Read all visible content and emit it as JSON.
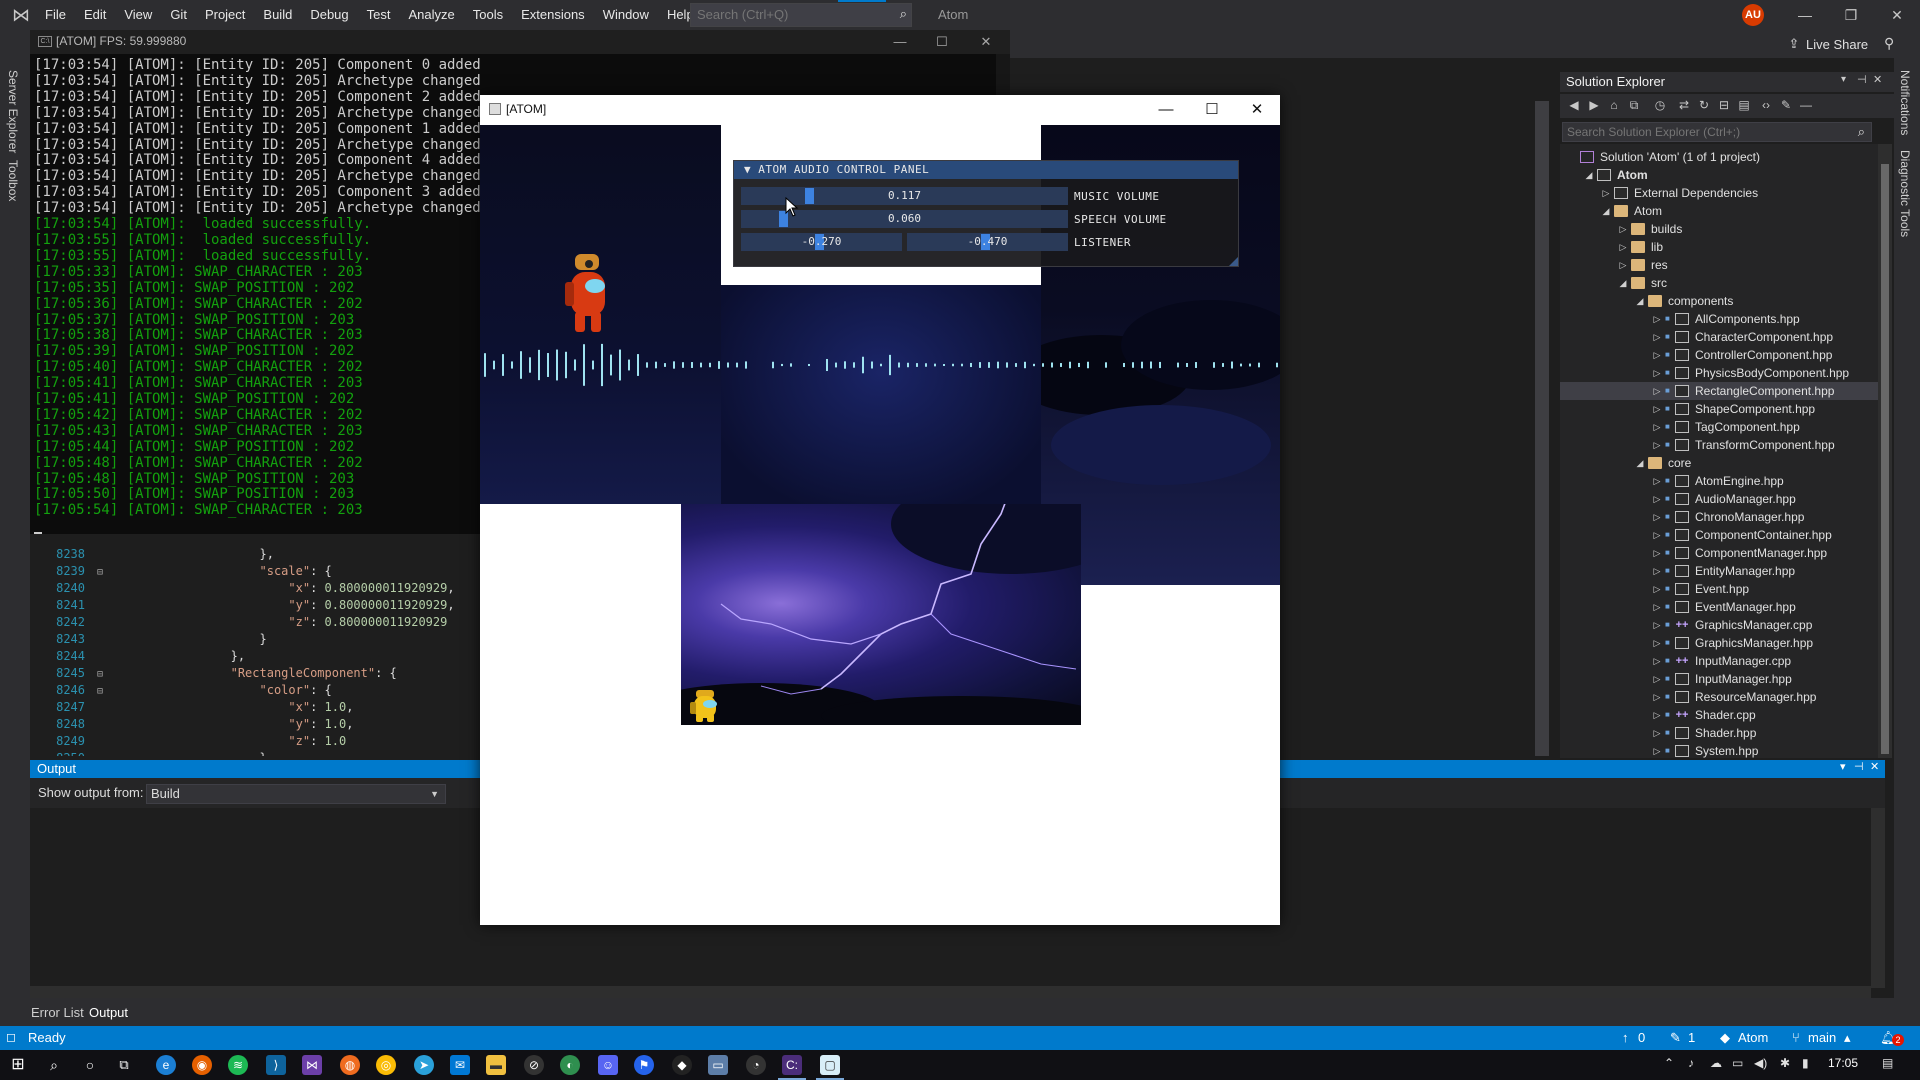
{
  "vs": {
    "menu": [
      "File",
      "Edit",
      "View",
      "Git",
      "Project",
      "Build",
      "Debug",
      "Test",
      "Analyze",
      "Tools",
      "Extensions",
      "Window",
      "Help"
    ],
    "search_placeholder": "Search (Ctrl+Q)",
    "solution_name": "Atom",
    "avatar_initials": "AU",
    "live_share": "Live Share",
    "left_tabs": [
      "Server Explorer",
      "Toolbox"
    ],
    "right_tabs": [
      "Notifications",
      "Diagnostic Tools"
    ]
  },
  "console": {
    "title": "[ATOM] FPS: 59.999880",
    "lines": [
      {
        "t": "[17:03:54] [ATOM]: [Entity ID: 205] Component 0 added",
        "c": "white"
      },
      {
        "t": "[17:03:54] [ATOM]: [Entity ID: 205] Archetype changed",
        "c": "white"
      },
      {
        "t": "[17:03:54] [ATOM]: [Entity ID: 205] Component 2 added",
        "c": "white"
      },
      {
        "t": "[17:03:54] [ATOM]: [Entity ID: 205] Archetype changed",
        "c": "white"
      },
      {
        "t": "[17:03:54] [ATOM]: [Entity ID: 205] Component 1 added",
        "c": "white"
      },
      {
        "t": "[17:03:54] [ATOM]: [Entity ID: 205] Archetype changed",
        "c": "white"
      },
      {
        "t": "[17:03:54] [ATOM]: [Entity ID: 205] Component 4 added",
        "c": "white"
      },
      {
        "t": "[17:03:54] [ATOM]: [Entity ID: 205] Archetype changed",
        "c": "white"
      },
      {
        "t": "[17:03:54] [ATOM]: [Entity ID: 205] Component 3 added",
        "c": "white"
      },
      {
        "t": "[17:03:54] [ATOM]: [Entity ID: 205] Archetype changed",
        "c": "white"
      },
      {
        "t": "[17:03:54] [ATOM]:  loaded successfully.",
        "c": "green"
      },
      {
        "t": "[17:03:55] [ATOM]:  loaded successfully.",
        "c": "green"
      },
      {
        "t": "[17:03:55] [ATOM]:  loaded successfully.",
        "c": "green"
      },
      {
        "t": "[17:05:33] [ATOM]: SWAP_CHARACTER : 203",
        "c": "green"
      },
      {
        "t": "[17:05:35] [ATOM]: SWAP_POSITION : 202",
        "c": "green"
      },
      {
        "t": "[17:05:36] [ATOM]: SWAP_CHARACTER : 202",
        "c": "green"
      },
      {
        "t": "[17:05:37] [ATOM]: SWAP_POSITION : 203",
        "c": "green"
      },
      {
        "t": "[17:05:38] [ATOM]: SWAP_CHARACTER : 203",
        "c": "green"
      },
      {
        "t": "[17:05:39] [ATOM]: SWAP_POSITION : 202",
        "c": "green"
      },
      {
        "t": "[17:05:40] [ATOM]: SWAP_CHARACTER : 202",
        "c": "green"
      },
      {
        "t": "[17:05:41] [ATOM]: SWAP_CHARACTER : 203",
        "c": "green"
      },
      {
        "t": "[17:05:41] [ATOM]: SWAP_POSITION : 202",
        "c": "green"
      },
      {
        "t": "[17:05:42] [ATOM]: SWAP_CHARACTER : 202",
        "c": "green"
      },
      {
        "t": "[17:05:43] [ATOM]: SWAP_CHARACTER : 203",
        "c": "green"
      },
      {
        "t": "[17:05:44] [ATOM]: SWAP_POSITION : 202",
        "c": "green"
      },
      {
        "t": "[17:05:48] [ATOM]: SWAP_CHARACTER : 202",
        "c": "green"
      },
      {
        "t": "[17:05:48] [ATOM]: SWAP_POSITION : 203",
        "c": "green"
      },
      {
        "t": "[17:05:50] [ATOM]: SWAP_POSITION : 203",
        "c": "green"
      },
      {
        "t": "[17:05:54] [ATOM]: SWAP_CHARACTER : 203",
        "c": "green"
      }
    ]
  },
  "editor": {
    "rows": [
      {
        "n": "8238",
        "fold": "",
        "code": [
          {
            "c": "pun",
            "t": "                    },"
          }
        ]
      },
      {
        "n": "8239",
        "fold": "⊟",
        "code": [
          {
            "c": "pun",
            "t": "                    "
          },
          {
            "c": "key",
            "t": "\"scale\""
          },
          {
            "c": "pun",
            "t": ": {"
          }
        ]
      },
      {
        "n": "8240",
        "fold": "",
        "code": [
          {
            "c": "pun",
            "t": "                        "
          },
          {
            "c": "key",
            "t": "\"x\""
          },
          {
            "c": "pun",
            "t": ": "
          },
          {
            "c": "num",
            "t": "0.800000011920929"
          },
          {
            "c": "pun",
            "t": ","
          }
        ]
      },
      {
        "n": "8241",
        "fold": "",
        "code": [
          {
            "c": "pun",
            "t": "                        "
          },
          {
            "c": "key",
            "t": "\"y\""
          },
          {
            "c": "pun",
            "t": ": "
          },
          {
            "c": "num",
            "t": "0.800000011920929"
          },
          {
            "c": "pun",
            "t": ","
          }
        ]
      },
      {
        "n": "8242",
        "fold": "",
        "code": [
          {
            "c": "pun",
            "t": "                        "
          },
          {
            "c": "key",
            "t": "\"z\""
          },
          {
            "c": "pun",
            "t": ": "
          },
          {
            "c": "num",
            "t": "0.800000011920929"
          }
        ]
      },
      {
        "n": "8243",
        "fold": "",
        "code": [
          {
            "c": "pun",
            "t": "                    }"
          }
        ]
      },
      {
        "n": "8244",
        "fold": "",
        "code": [
          {
            "c": "pun",
            "t": "                },"
          }
        ]
      },
      {
        "n": "8245",
        "fold": "⊟",
        "code": [
          {
            "c": "pun",
            "t": "                "
          },
          {
            "c": "key",
            "t": "\"RectangleComponent\""
          },
          {
            "c": "pun",
            "t": ": {"
          }
        ]
      },
      {
        "n": "8246",
        "fold": "⊟",
        "code": [
          {
            "c": "pun",
            "t": "                    "
          },
          {
            "c": "key",
            "t": "\"color\""
          },
          {
            "c": "pun",
            "t": ": {"
          }
        ]
      },
      {
        "n": "8247",
        "fold": "",
        "code": [
          {
            "c": "pun",
            "t": "                        "
          },
          {
            "c": "key",
            "t": "\"x\""
          },
          {
            "c": "pun",
            "t": ": "
          },
          {
            "c": "num",
            "t": "1.0"
          },
          {
            "c": "pun",
            "t": ","
          }
        ]
      },
      {
        "n": "8248",
        "fold": "",
        "code": [
          {
            "c": "pun",
            "t": "                        "
          },
          {
            "c": "key",
            "t": "\"y\""
          },
          {
            "c": "pun",
            "t": ": "
          },
          {
            "c": "num",
            "t": "1.0"
          },
          {
            "c": "pun",
            "t": ","
          }
        ]
      },
      {
        "n": "8249",
        "fold": "",
        "code": [
          {
            "c": "pun",
            "t": "                        "
          },
          {
            "c": "key",
            "t": "\"z\""
          },
          {
            "c": "pun",
            "t": ": "
          },
          {
            "c": "num",
            "t": "1.0"
          }
        ]
      },
      {
        "n": "8250",
        "fold": "",
        "code": [
          {
            "c": "pun",
            "t": "                    },"
          }
        ]
      }
    ]
  },
  "output": {
    "title": "Output",
    "show_from_label": "Show output from:",
    "source": "Build"
  },
  "bottom_tabs": [
    "Error List",
    "Output"
  ],
  "solution_explorer": {
    "title": "Solution Explorer",
    "search_placeholder": "Search Solution Explorer (Ctrl+;)",
    "tree": [
      {
        "label": "Solution 'Atom' (1 of 1 project)",
        "depth": 0,
        "icon": "sol",
        "arrow": ""
      },
      {
        "label": "Atom",
        "depth": 1,
        "icon": "proj",
        "arrow": "open",
        "bold": true
      },
      {
        "label": "External Dependencies",
        "depth": 2,
        "icon": "ext",
        "arrow": "closed"
      },
      {
        "label": "Atom",
        "depth": 2,
        "icon": "folder",
        "arrow": "open"
      },
      {
        "label": "builds",
        "depth": 3,
        "icon": "folder",
        "arrow": "closed"
      },
      {
        "label": "lib",
        "depth": 3,
        "icon": "folder",
        "arrow": "closed"
      },
      {
        "label": "res",
        "depth": 3,
        "icon": "folder",
        "arrow": "closed"
      },
      {
        "label": "src",
        "depth": 3,
        "icon": "folder",
        "arrow": "open"
      },
      {
        "label": "components",
        "depth": 4,
        "icon": "folder",
        "arrow": "open"
      },
      {
        "label": "AllComponents.hpp",
        "depth": 5,
        "icon": "file",
        "arrow": "closed"
      },
      {
        "label": "CharacterComponent.hpp",
        "depth": 5,
        "icon": "file",
        "arrow": "closed"
      },
      {
        "label": "ControllerComponent.hpp",
        "depth": 5,
        "icon": "file",
        "arrow": "closed"
      },
      {
        "label": "PhysicsBodyComponent.hpp",
        "depth": 5,
        "icon": "file",
        "arrow": "closed"
      },
      {
        "label": "RectangleComponent.hpp",
        "depth": 5,
        "icon": "file",
        "arrow": "closed",
        "selected": true
      },
      {
        "label": "ShapeComponent.hpp",
        "depth": 5,
        "icon": "file",
        "arrow": "closed"
      },
      {
        "label": "TagComponent.hpp",
        "depth": 5,
        "icon": "file",
        "arrow": "closed"
      },
      {
        "label": "TransformComponent.hpp",
        "depth": 5,
        "icon": "file",
        "arrow": "closed"
      },
      {
        "label": "core",
        "depth": 4,
        "icon": "folder",
        "arrow": "open"
      },
      {
        "label": "AtomEngine.hpp",
        "depth": 5,
        "icon": "file",
        "arrow": "closed"
      },
      {
        "label": "AudioManager.hpp",
        "depth": 5,
        "icon": "file",
        "arrow": "closed"
      },
      {
        "label": "ChronoManager.hpp",
        "depth": 5,
        "icon": "file",
        "arrow": "closed"
      },
      {
        "label": "ComponentContainer.hpp",
        "depth": 5,
        "icon": "file",
        "arrow": "closed"
      },
      {
        "label": "ComponentManager.hpp",
        "depth": 5,
        "icon": "file",
        "arrow": "closed"
      },
      {
        "label": "EntityManager.hpp",
        "depth": 5,
        "icon": "file",
        "arrow": "closed"
      },
      {
        "label": "Event.hpp",
        "depth": 5,
        "icon": "file",
        "arrow": "closed"
      },
      {
        "label": "EventManager.hpp",
        "depth": 5,
        "icon": "file",
        "arrow": "closed"
      },
      {
        "label": "GraphicsManager.cpp",
        "depth": 5,
        "icon": "cpp",
        "arrow": "closed"
      },
      {
        "label": "GraphicsManager.hpp",
        "depth": 5,
        "icon": "file",
        "arrow": "closed"
      },
      {
        "label": "InputManager.cpp",
        "depth": 5,
        "icon": "cpp",
        "arrow": "closed"
      },
      {
        "label": "InputManager.hpp",
        "depth": 5,
        "icon": "file",
        "arrow": "closed"
      },
      {
        "label": "ResourceManager.hpp",
        "depth": 5,
        "icon": "file",
        "arrow": "closed"
      },
      {
        "label": "Shader.cpp",
        "depth": 5,
        "icon": "cpp",
        "arrow": "closed"
      },
      {
        "label": "Shader.hpp",
        "depth": 5,
        "icon": "file",
        "arrow": "closed"
      },
      {
        "label": "System.hpp",
        "depth": 5,
        "icon": "file",
        "arrow": "closed"
      }
    ]
  },
  "atom_window": {
    "title": "[ATOM]"
  },
  "audio_panel": {
    "title": "ATOM AUDIO CONTROL PANEL",
    "music_volume": {
      "label": "MUSIC VOLUME",
      "value": "0.117",
      "fraction": 0.117
    },
    "speech_volume": {
      "label": "SPEECH VOLUME",
      "value": "0.060",
      "fraction": 0.06
    },
    "listener": {
      "label": "LISTENER",
      "x": "-0.270",
      "y": "-0.470"
    }
  },
  "status_bar": {
    "ready": "Ready",
    "up_count": "0",
    "edit_count": "1",
    "repo": "Atom",
    "branch": "main",
    "notifications": "2"
  },
  "taskbar": {
    "time": "17:05"
  },
  "colors": {
    "accent": "#007acc",
    "console_green": "#13a10e",
    "imgui_header": "#294a7a",
    "imgui_grab": "#3d82e0"
  }
}
